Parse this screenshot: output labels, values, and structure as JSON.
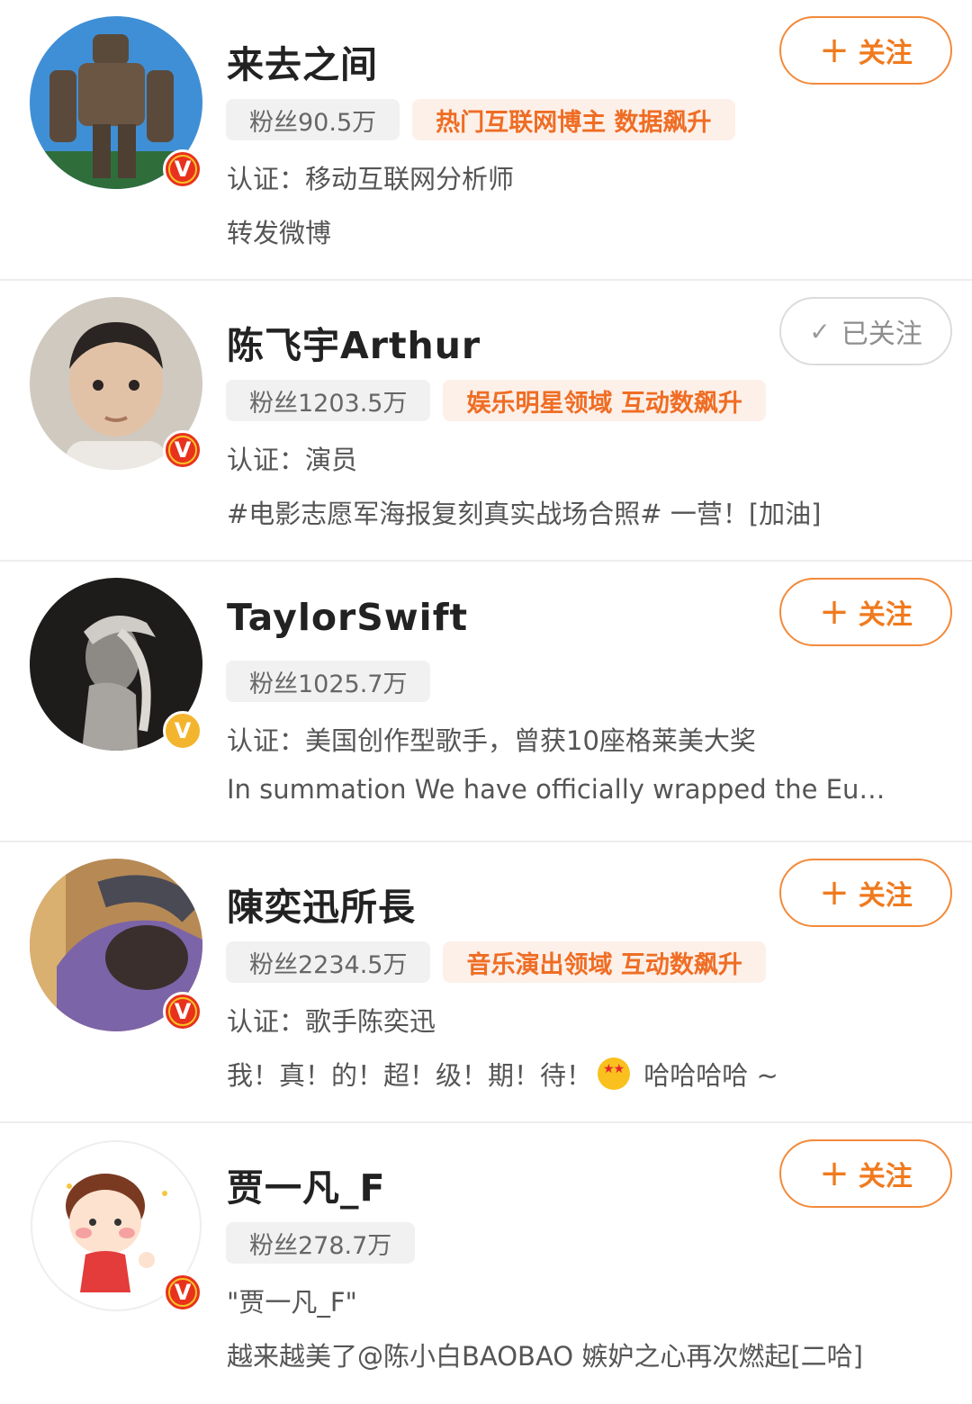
{
  "labels": {
    "fans_prefix": "粉丝 ",
    "follow": "关注",
    "followed": "已关注",
    "verified_badge": "V"
  },
  "users": [
    {
      "name": "来去之间",
      "fans": "90.5万",
      "tag": "热门互联网博主 数据飙升",
      "cert": "认证：移动互联网分析师",
      "desc": "转发微博",
      "following": false,
      "badge_color": "#e8321d"
    },
    {
      "name": "陈飞宇Arthur",
      "fans": "1203.5万",
      "tag": "娱乐明星领域 互动数飙升",
      "cert": "认证：演员",
      "desc": "#电影志愿军海报复刻真实战场合照# 一营！[加油]",
      "following": true,
      "badge_color": "#e8321d"
    },
    {
      "name": "TaylorSwift",
      "fans": "1025.7万",
      "tag": "",
      "cert": "认证：美国创作型歌手，曾获10座格莱美大奖",
      "desc": "In summation We have officially wrapped the Eu…",
      "following": false,
      "badge_color": "#f3b52e"
    },
    {
      "name": "陳奕迅所長",
      "fans": "2234.5万",
      "tag": "音乐演出领域 互动数飙升",
      "cert": "认证：歌手陈奕迅",
      "desc_before": "我！真！的！超！级！期！待！",
      "desc_after": " 哈哈哈哈 ~",
      "emoji": "star-eyes-emoji",
      "following": false,
      "badge_color": "#e8321d"
    },
    {
      "name": "贾一凡_F",
      "fans": "278.7万",
      "tag": "",
      "cert": "\"贾一凡_F\"",
      "desc": "越来越美了@陈小白BAOBAO 嫉妒之心再次燃起[二哈]",
      "following": false,
      "badge_color": "#e8321d"
    }
  ]
}
